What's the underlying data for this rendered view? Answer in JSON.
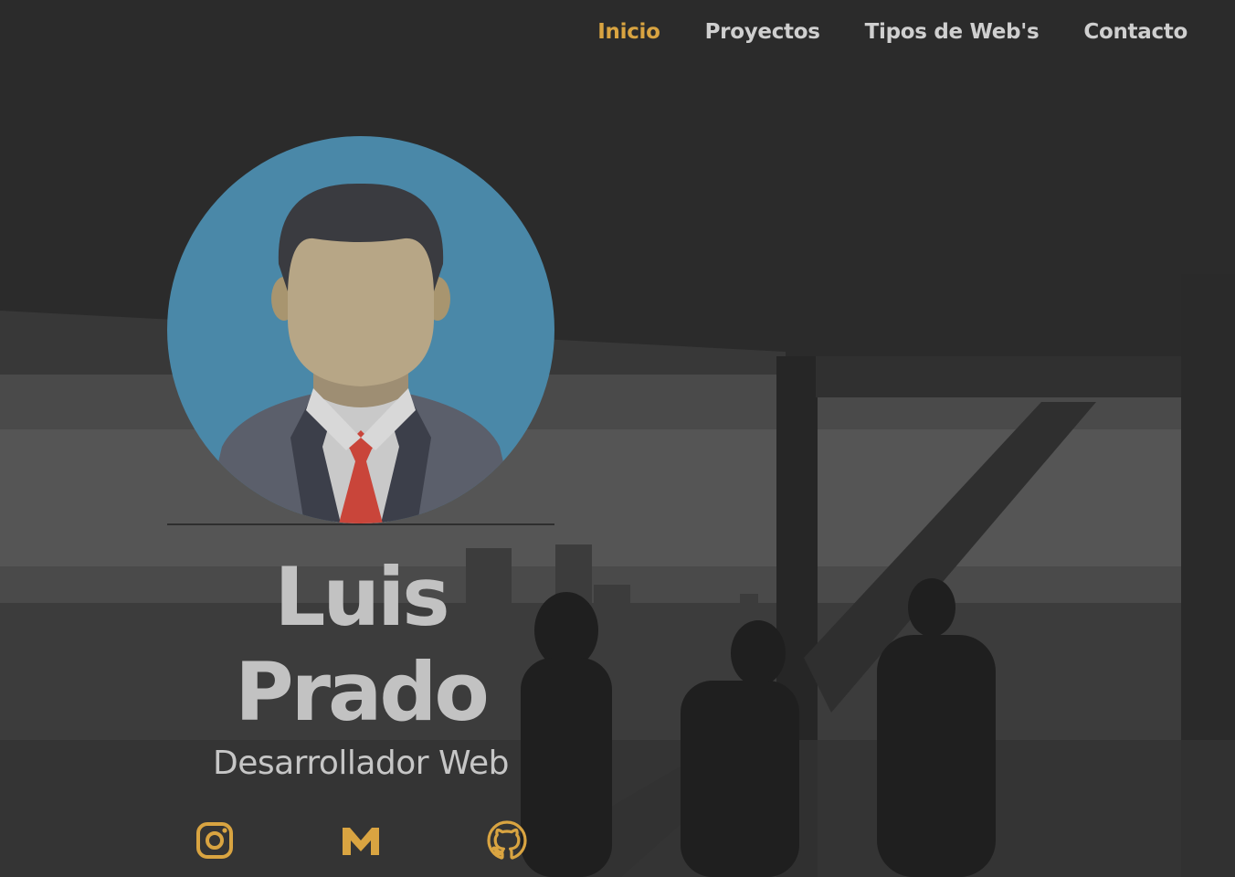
{
  "nav": {
    "items": [
      {
        "label": "Inicio",
        "active": true
      },
      {
        "label": "Proyectos",
        "active": false
      },
      {
        "label": "Tipos de Web's",
        "active": false
      },
      {
        "label": "Contacto",
        "active": false
      }
    ],
    "active_color": "#d9a441",
    "text_color": "#cfcfcf"
  },
  "profile": {
    "first_name": "Luis",
    "last_name": "Prado",
    "role": "Desarrollador Web",
    "avatar_icon": "businessman-avatar-icon",
    "avatar_bg_color": "#4a88a8"
  },
  "social": {
    "icon_color": "#d9a441",
    "items": [
      {
        "icon": "instagram-icon"
      },
      {
        "icon": "gmail-icon"
      },
      {
        "icon": "github-icon"
      }
    ]
  },
  "background": {
    "description_icon": "city-office-photo",
    "overlay_color": "#2b2b2b"
  }
}
